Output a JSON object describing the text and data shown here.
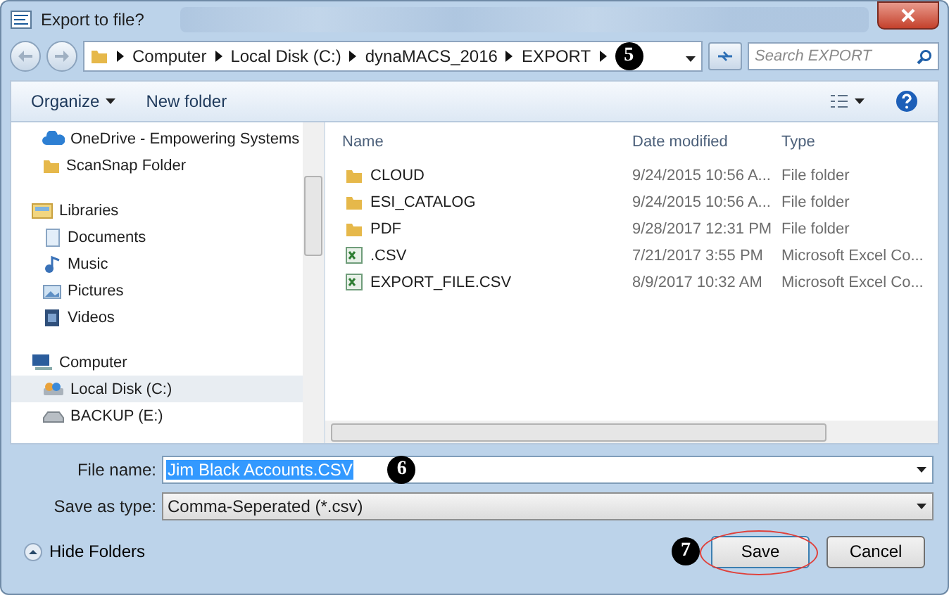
{
  "window": {
    "title": "Export to file?"
  },
  "breadcrumbs": [
    "Computer",
    "Local Disk (C:)",
    "dynaMACS_2016",
    "EXPORT"
  ],
  "search": {
    "placeholder": "Search EXPORT"
  },
  "toolbar": {
    "organize": "Organize",
    "new_folder": "New folder"
  },
  "nav": [
    {
      "label": "OneDrive - Empowering Systems",
      "kind": "cloud",
      "group": false,
      "selected": false
    },
    {
      "label": "ScanSnap Folder",
      "kind": "folder",
      "group": false,
      "selected": false
    },
    {
      "label": "Libraries",
      "kind": "library",
      "group": true,
      "selected": false
    },
    {
      "label": "Documents",
      "kind": "doc",
      "group": false,
      "selected": false
    },
    {
      "label": "Music",
      "kind": "music",
      "group": false,
      "selected": false
    },
    {
      "label": "Pictures",
      "kind": "pic",
      "group": false,
      "selected": false
    },
    {
      "label": "Videos",
      "kind": "video",
      "group": false,
      "selected": false
    },
    {
      "label": "Computer",
      "kind": "computer",
      "group": true,
      "selected": false
    },
    {
      "label": "Local Disk (C:)",
      "kind": "disk",
      "group": false,
      "selected": true
    },
    {
      "label": "BACKUP (E:)",
      "kind": "drive",
      "group": false,
      "selected": false
    }
  ],
  "table": {
    "columns": [
      "Name",
      "Date modified",
      "Type"
    ],
    "rows": [
      {
        "kind": "folder",
        "cells": [
          "CLOUD",
          "9/24/2015 10:56 A...",
          "File folder"
        ]
      },
      {
        "kind": "folder",
        "cells": [
          "ESI_CATALOG",
          "9/24/2015 10:56 A...",
          "File folder"
        ]
      },
      {
        "kind": "folder",
        "cells": [
          "PDF",
          "9/28/2017 12:31 PM",
          "File folder"
        ]
      },
      {
        "kind": "csv",
        "cells": [
          ".CSV",
          "7/21/2017 3:55 PM",
          "Microsoft Excel Co..."
        ]
      },
      {
        "kind": "csv",
        "cells": [
          "EXPORT_FILE.CSV",
          "8/9/2017 10:32 AM",
          "Microsoft Excel Co..."
        ]
      }
    ]
  },
  "file_name": {
    "label": "File name:",
    "value": "Jim Black Accounts.CSV",
    "selected": true
  },
  "save_type": {
    "label": "Save as type:",
    "value": "Comma-Seperated (*.csv)"
  },
  "hide_folders": "Hide Folders",
  "buttons": {
    "save": "Save",
    "cancel": "Cancel"
  },
  "callouts": [
    "5",
    "6",
    "7"
  ]
}
